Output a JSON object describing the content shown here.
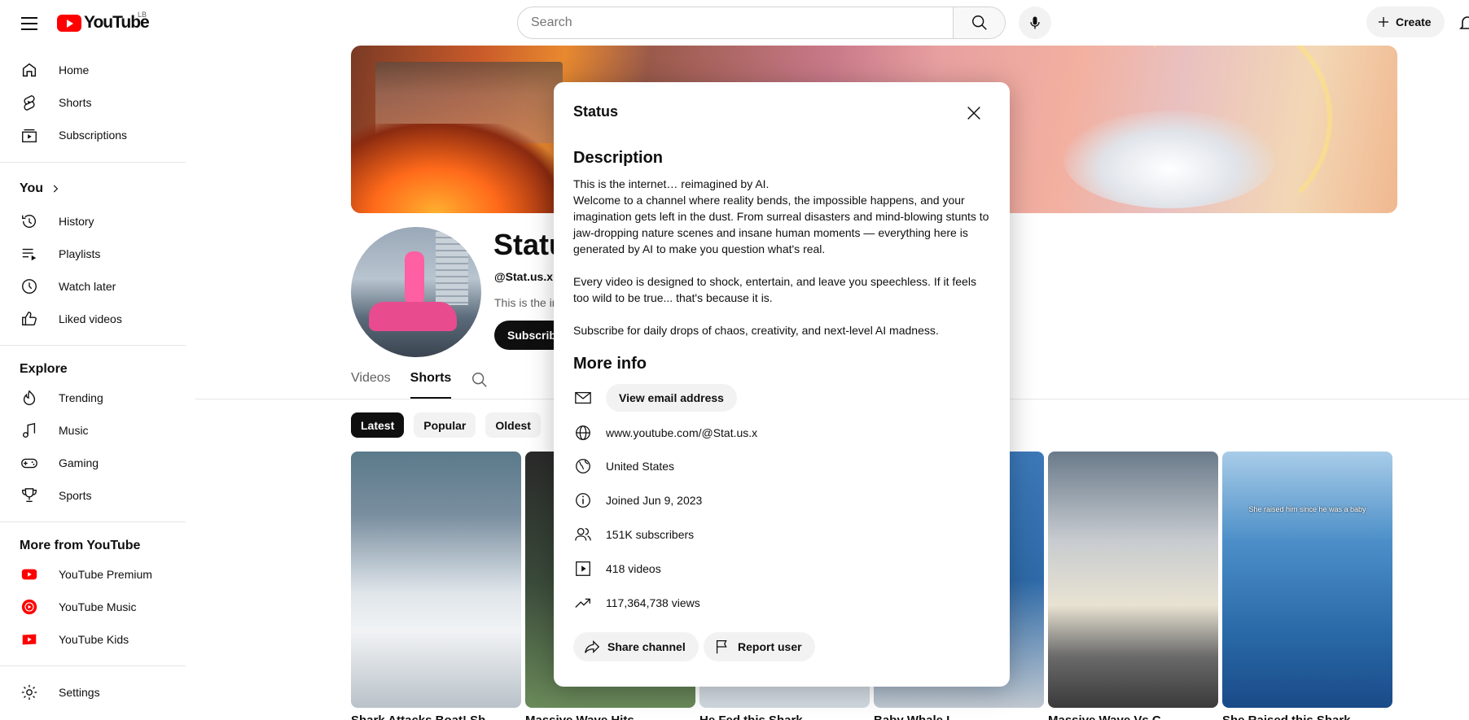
{
  "header": {
    "logo_text": "YouTube",
    "country_code": "LB",
    "search_placeholder": "Search",
    "create_label": "Create"
  },
  "sidebar": {
    "main": [
      {
        "label": "Home",
        "icon": "home-icon"
      },
      {
        "label": "Shorts",
        "icon": "shorts-icon"
      },
      {
        "label": "Subscriptions",
        "icon": "subscriptions-icon"
      }
    ],
    "you_heading": "You",
    "you": [
      {
        "label": "History",
        "icon": "history-icon"
      },
      {
        "label": "Playlists",
        "icon": "playlists-icon"
      },
      {
        "label": "Watch later",
        "icon": "clock-icon"
      },
      {
        "label": "Liked videos",
        "icon": "thumbs-up-icon"
      }
    ],
    "explore_heading": "Explore",
    "explore": [
      {
        "label": "Trending",
        "icon": "trending-icon"
      },
      {
        "label": "Music",
        "icon": "music-icon"
      },
      {
        "label": "Gaming",
        "icon": "gaming-icon"
      },
      {
        "label": "Sports",
        "icon": "trophy-icon"
      }
    ],
    "more_heading": "More from YouTube",
    "more": [
      {
        "label": "YouTube Premium",
        "icon": "youtube-premium-icon"
      },
      {
        "label": "YouTube Music",
        "icon": "youtube-music-icon"
      },
      {
        "label": "YouTube Kids",
        "icon": "youtube-kids-icon"
      }
    ],
    "settings_label": "Settings"
  },
  "channel": {
    "name": "Statu",
    "handle": "@Stat.us.x ·",
    "description_preview": "This is the in",
    "subscribe_label": "Subscribe",
    "tabs": [
      "Videos",
      "Shorts"
    ],
    "active_tab": "Shorts",
    "chips": [
      "Latest",
      "Popular",
      "Oldest"
    ],
    "active_chip": "Latest",
    "shorts": [
      {
        "title": "Shark Attacks Boat! Sh"
      },
      {
        "title": "Massive Wave Hits"
      },
      {
        "title": "He Fed this Shark"
      },
      {
        "title": "Baby Whale L"
      },
      {
        "title": "Massive Wave Vs C"
      },
      {
        "title": "She Raised this Shark"
      }
    ],
    "short6_caption": "She raised him since he was a baby"
  },
  "modal": {
    "title": "Status",
    "description_heading": "Description",
    "description": "This is the internet… reimagined by AI.\nWelcome to a channel where reality bends, the impossible happens, and your imagination gets left in the dust. From surreal disasters and mind-blowing stunts to jaw-dropping nature scenes and insane human moments — everything here is generated by AI to make you question what's real.\n\nEvery video is designed to shock, entertain, and leave you speechless. If it feels too wild to be true... that's because it is.\n\nSubscribe for daily drops of chaos, creativity, and next-level AI madness.",
    "more_info_heading": "More info",
    "email_button": "View email address",
    "url": "www.youtube.com/@Stat.us.x",
    "country": "United States",
    "joined": "Joined Jun 9, 2023",
    "subscribers": "151K subscribers",
    "videos": "418 videos",
    "views": "117,364,738 views",
    "share_button": "Share channel",
    "report_button": "Report user"
  },
  "colors": {
    "brand_red": "#ff0000",
    "text_primary": "#0f0f0f",
    "text_secondary": "#606060",
    "chip_bg": "#f2f2f2"
  }
}
